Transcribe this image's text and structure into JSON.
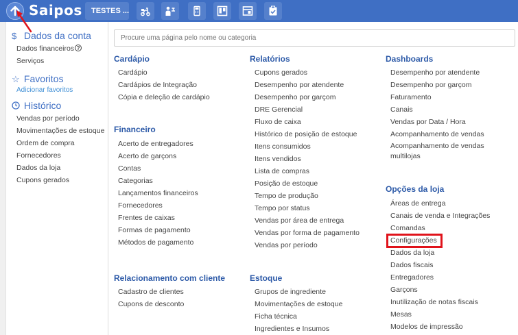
{
  "topbar": {
    "logo": "Saipos",
    "store_label": "TESTES ...",
    "icons": [
      "up-arrow-icon",
      "delivery-icon",
      "waiter-icon",
      "pos-icon",
      "kanban-icon",
      "dashboard-icon",
      "checklist-icon"
    ]
  },
  "sidebar": {
    "account": {
      "title": "Dados da conta",
      "icon": "dollar-icon",
      "items": [
        "Dados financeiros",
        "Serviços"
      ]
    },
    "favorites": {
      "title": "Favoritos",
      "icon": "star-icon",
      "add_link": "Adicionar favoritos"
    },
    "history": {
      "title": "Histórico",
      "icon": "clock-icon",
      "items": [
        "Vendas por período",
        "Movimentações de estoque",
        "Ordem de compra",
        "Fornecedores",
        "Dados da loja",
        "Cupons gerados"
      ]
    }
  },
  "search": {
    "placeholder": "Procure uma página pelo nome ou categoria"
  },
  "categories": {
    "cardapio": {
      "title": "Cardápio",
      "items": [
        "Cardápio",
        "Cardápios de Integração",
        "Cópia e deleção de cardápio"
      ]
    },
    "financeiro": {
      "title": "Financeiro",
      "items": [
        "Acerto de entregadores",
        "Acerto de garçons",
        "Contas",
        "Categorias",
        "Lançamentos financeiros",
        "Fornecedores",
        "Frentes de caixas",
        "Formas de pagamento",
        "Métodos de pagamento"
      ]
    },
    "relacionamento": {
      "title": "Relacionamento com cliente",
      "items": [
        "Cadastro de clientes",
        "Cupons de desconto"
      ]
    },
    "relatorios": {
      "title": "Relatórios",
      "items": [
        "Cupons gerados",
        "Desempenho por atendente",
        "Desempenho por garçom",
        "DRE Gerencial",
        "Fluxo de caixa",
        "Histórico de posição de estoque",
        "Itens consumidos",
        "Itens vendidos",
        "Lista de compras",
        "Posição de estoque",
        "Tempo de produção",
        "Tempo por status",
        "Vendas por área de entrega",
        "Vendas por forma de pagamento",
        "Vendas por período"
      ]
    },
    "estoque": {
      "title": "Estoque",
      "items": [
        "Grupos de ingrediente",
        "Movimentações de estoque",
        "Ficha técnica",
        "Ingredientes e Insumos"
      ]
    },
    "dashboards": {
      "title": "Dashboards",
      "items": [
        "Desempenho por atendente",
        "Desempenho por garçom",
        "Faturamento",
        "Canais",
        "Vendas por Data / Hora",
        "Acompanhamento de vendas",
        "Acompanhamento de vendas multilojas"
      ]
    },
    "opcoes": {
      "title": "Opções da loja",
      "items": [
        "Áreas de entrega",
        "Canais de venda e Integrações",
        "Comandas",
        "Configurações",
        "Dados da loja",
        "Dados fiscais",
        "Entregadores",
        "Garçons",
        "Inutilização de notas fiscais",
        "Mesas",
        "Modelos de impressão"
      ]
    }
  },
  "colors": {
    "topbar": "#3f6fc4",
    "accent": "#3f6fc4",
    "title": "#2d5aa8",
    "highlight": "#e0131b"
  }
}
